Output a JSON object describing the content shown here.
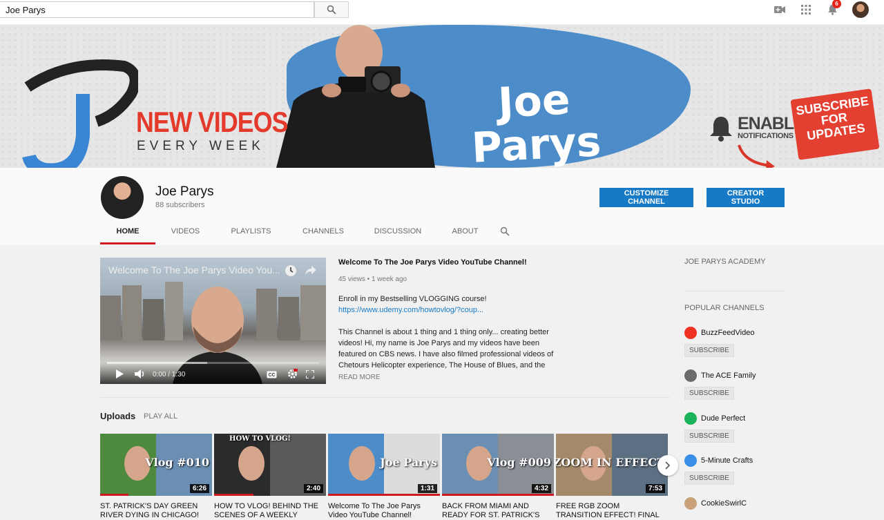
{
  "search": {
    "value": "Joe Parys"
  },
  "topbar": {
    "notifications_count": "6",
    "icons": [
      "upload-video-icon",
      "apps-grid-icon",
      "bell-icon",
      "account-avatar"
    ]
  },
  "banner": {
    "tagline_top": "NEW VIDEOS",
    "tagline_bottom": "EVERY WEEK",
    "name_line1": "Joe",
    "name_line2": "Parys",
    "enable_line1": "ENABLE",
    "enable_line2": "NOTIFICATIONS",
    "subscribe_line1": "SUBSCRIBE",
    "subscribe_line2": "FOR",
    "subscribe_line3": "UPDATES",
    "accent": "#e33a2c",
    "splash": "#4b8cc9"
  },
  "channel": {
    "name": "Joe Parys",
    "subscribers": "88 subscribers",
    "customize_label": "CUSTOMIZE CHANNEL",
    "studio_label": "CREATOR STUDIO"
  },
  "tabs": [
    {
      "label": "HOME",
      "active": true
    },
    {
      "label": "VIDEOS"
    },
    {
      "label": "PLAYLISTS"
    },
    {
      "label": "CHANNELS"
    },
    {
      "label": "DISCUSSION"
    },
    {
      "label": "ABOUT"
    }
  ],
  "featured": {
    "player_title": "Welcome To The Joe Parys Video You...",
    "time": "0:00 / 1:30",
    "progress": 0.0,
    "title": "Welcome To The Joe Parys Video YouTube Channel!",
    "meta": "45 views • 1 week ago",
    "desc1": "Enroll in my Bestselling VLOGGING course!",
    "link": "https://www.udemy.com/howtovlog/?coup...",
    "desc2": "This Channel is about 1 thing and 1 thing only... creating better videos! Hi, my name is Joe Parys and my videos have been featured on CBS news. I have also filmed professional videos of Chetours Helicopter experience, The House of Blues, and the",
    "read_more": "READ MORE"
  },
  "uploads": {
    "heading": "Uploads",
    "play_all": "PLAY ALL",
    "videos": [
      {
        "title_l1": "ST. PATRICK'S DAY GREEN",
        "title_l2": "RIVER DYING IN CHICAGO!",
        "duration": "6:26",
        "overlay": "Vlog #010",
        "watched": 0.25
      },
      {
        "title_l1": "HOW TO VLOG! BEHIND THE",
        "title_l2": "SCENES OF A WEEKLY",
        "duration": "2:40",
        "overlay": "HOW TO VLOG!",
        "watched": 0.35
      },
      {
        "title_l1": "Welcome To The Joe Parys",
        "title_l2": "Video YouTube Channel!",
        "duration": "1:31",
        "overlay": "Joe Parys",
        "watched": 1.0
      },
      {
        "title_l1": "BACK FROM MIAMI AND",
        "title_l2": "READY FOR ST. PATRICK'S",
        "duration": "4:32",
        "overlay": "Vlog #009",
        "watched": 1.0
      },
      {
        "title_l1": "FREE RGB ZOOM",
        "title_l2": "TRANSITION EFFECT! FINAL",
        "duration": "7:53",
        "overlay": "ZOOM IN EFFECT",
        "watched": 0.0
      }
    ]
  },
  "sidebar": {
    "academy": "JOE PARYS ACADEMY",
    "popular_heading": "POPULAR CHANNELS",
    "subscribe_label": "SUBSCRIBE",
    "channels": [
      {
        "name": "BuzzFeedVideo",
        "color": "#ee3322"
      },
      {
        "name": "The ACE Family",
        "color": "#6b6b6b"
      },
      {
        "name": "Dude Perfect",
        "color": "#1bb35a"
      },
      {
        "name": "5-Minute Crafts",
        "color": "#3a8ee6"
      },
      {
        "name": "CookieSwirlC",
        "color": "#c9a27a"
      }
    ]
  }
}
